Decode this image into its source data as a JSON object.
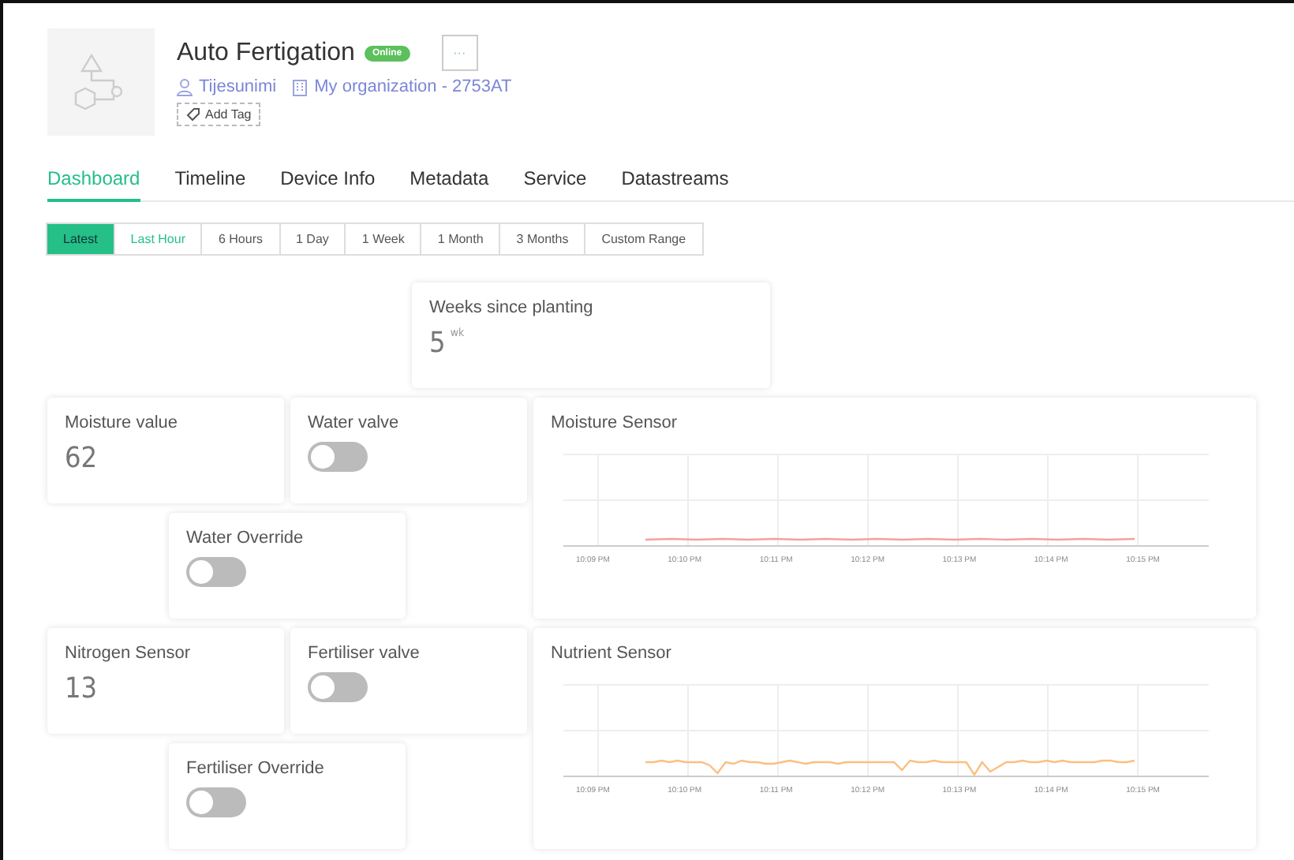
{
  "device": {
    "title": "Auto Fertigation",
    "status": "Online",
    "owner": "Tijesunimi",
    "organization": "My organization - 2753AT",
    "tag_button": "Add Tag",
    "more_button": "···"
  },
  "tabs": [
    {
      "label": "Dashboard",
      "selected": true
    },
    {
      "label": "Timeline",
      "selected": false
    },
    {
      "label": "Device Info",
      "selected": false
    },
    {
      "label": "Metadata",
      "selected": false
    },
    {
      "label": "Service",
      "selected": false
    },
    {
      "label": "Datastreams",
      "selected": false
    }
  ],
  "ranges": [
    {
      "label": "Latest",
      "selected": true
    },
    {
      "label": "Last Hour",
      "selected": false
    },
    {
      "label": "6 Hours",
      "selected": false
    },
    {
      "label": "1 Day",
      "selected": false
    },
    {
      "label": "1 Week",
      "selected": false
    },
    {
      "label": "1 Month",
      "selected": false
    },
    {
      "label": "3 Months",
      "selected": false
    },
    {
      "label": "Custom Range",
      "selected": false
    }
  ],
  "widgets": [
    {
      "kind": "value",
      "title": "Weeks since planting",
      "value": "5",
      "unit": "wk"
    },
    {
      "kind": "value",
      "title": "Moisture value",
      "value": "62"
    },
    {
      "kind": "switch",
      "title": "Water valve",
      "on": false
    },
    {
      "kind": "chart",
      "title": "Moisture Sensor",
      "color": "#f4a0a0",
      "x_labels": [
        "10:09 PM",
        "10:10 PM",
        "10:11 PM",
        "10:12 PM",
        "10:13 PM",
        "10:14 PM",
        "10:15 PM"
      ]
    },
    {
      "kind": "switch",
      "title": "Water Override",
      "on": false
    },
    {
      "kind": "value",
      "title": "Nitrogen Sensor",
      "value": "13"
    },
    {
      "kind": "switch",
      "title": "Fertiliser valve",
      "on": false
    },
    {
      "kind": "chart",
      "title": "Nutrient Sensor",
      "color": "#fbbf80",
      "x_labels": [
        "10:09 PM",
        "10:10 PM",
        "10:11 PM",
        "10:12 PM",
        "10:13 PM",
        "10:14 PM",
        "10:15 PM"
      ]
    },
    {
      "kind": "switch",
      "title": "Fertiliser Override",
      "on": false
    }
  ]
}
